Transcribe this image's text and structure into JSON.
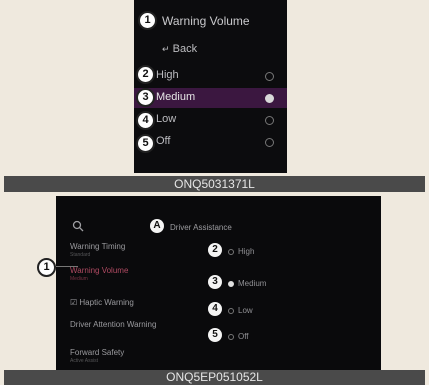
{
  "top_panel": {
    "title": "Warning Volume",
    "back_label": "Back",
    "options": [
      {
        "label": "High",
        "selected": false
      },
      {
        "label": "Medium",
        "selected": true
      },
      {
        "label": "Low",
        "selected": false
      },
      {
        "label": "Off",
        "selected": false
      }
    ],
    "callouts": [
      "1",
      "2",
      "3",
      "4",
      "5"
    ],
    "caption": "ONQ5031371L"
  },
  "bottom_panel": {
    "header": "Driver Assistance",
    "header_callout": "A",
    "side_callout": "1",
    "menu_items": [
      {
        "label": "Warning Timing",
        "sub": "Standard"
      },
      {
        "label": "Warning Volume",
        "sub": "Medium"
      },
      {
        "label": "Haptic Warning",
        "sub": ""
      },
      {
        "label": "Driver Attention Warning",
        "sub": ""
      },
      {
        "label": "Forward Safety",
        "sub": "Active Assist"
      }
    ],
    "active_index": 1,
    "haptic_checked": true,
    "options": [
      {
        "label": "High",
        "callout": "2",
        "selected": false
      },
      {
        "label": "Medium",
        "callout": "3",
        "selected": true
      },
      {
        "label": "Low",
        "callout": "4",
        "selected": false
      },
      {
        "label": "Off",
        "callout": "5",
        "selected": false
      }
    ],
    "caption": "ONQ5EP051052L"
  }
}
